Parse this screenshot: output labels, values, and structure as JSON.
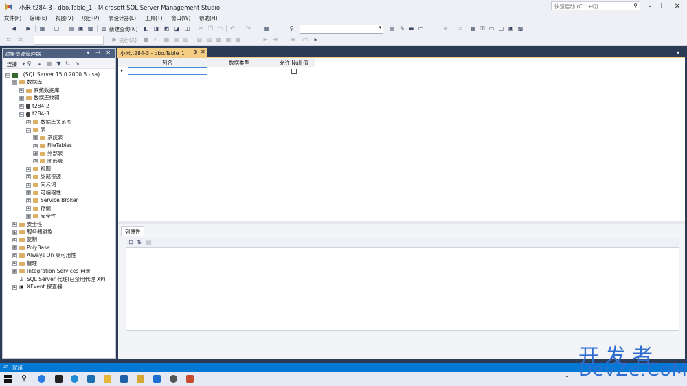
{
  "window": {
    "title": "小米.t284-3 - dbo.Table_1 - Microsoft SQL Server Management Studio",
    "quick_launch_placeholder": "快速启动 (Ctrl+Q)"
  },
  "menu": [
    "文件(F)",
    "编辑(E)",
    "视图(V)",
    "项目(P)",
    "表设计器(L)",
    "工具(T)",
    "窗口(W)",
    "帮助(H)"
  ],
  "toolbar": {
    "new_query_label": "新建查询(N)",
    "execute_label": "执行(X)"
  },
  "object_explorer": {
    "title": "对象资源管理器",
    "header_controls": "▾ ⊣ ✕",
    "connect_label": "连接",
    "tree": [
      {
        "label": ". (SQL Server 15.0.2000.5 - sa)",
        "level": 0,
        "icon": "server-icon",
        "expand": "⊟"
      },
      {
        "label": "数据库",
        "level": 1,
        "icon": "folder-icon",
        "expand": "⊟"
      },
      {
        "label": "系统数据库",
        "level": 2,
        "icon": "folder-icon",
        "expand": "⊞"
      },
      {
        "label": "数据库快照",
        "level": 2,
        "icon": "folder-icon",
        "expand": "⊞"
      },
      {
        "label": "t284-2",
        "level": 2,
        "icon": "database-icon",
        "expand": "⊞"
      },
      {
        "label": "t284-3",
        "level": 2,
        "icon": "database-icon",
        "expand": "⊟"
      },
      {
        "label": "数据库关系图",
        "level": 3,
        "icon": "folder-icon",
        "expand": "⊞"
      },
      {
        "label": "表",
        "level": 3,
        "icon": "folder-icon",
        "expand": "⊟"
      },
      {
        "label": "系统表",
        "level": 4,
        "icon": "folder-icon",
        "expand": "⊞"
      },
      {
        "label": "FileTables",
        "level": 4,
        "icon": "folder-icon",
        "expand": "⊞"
      },
      {
        "label": "外部表",
        "level": 4,
        "icon": "folder-icon",
        "expand": "⊞"
      },
      {
        "label": "图形表",
        "level": 4,
        "icon": "folder-icon",
        "expand": "⊞"
      },
      {
        "label": "视图",
        "level": 3,
        "icon": "folder-icon",
        "expand": "⊞"
      },
      {
        "label": "外部资源",
        "level": 3,
        "icon": "folder-icon",
        "expand": "⊞"
      },
      {
        "label": "同义词",
        "level": 3,
        "icon": "folder-icon",
        "expand": "⊞"
      },
      {
        "label": "可编程性",
        "level": 3,
        "icon": "folder-icon",
        "expand": "⊞"
      },
      {
        "label": "Service Broker",
        "level": 3,
        "icon": "folder-icon",
        "expand": "⊞"
      },
      {
        "label": "存储",
        "level": 3,
        "icon": "folder-icon",
        "expand": "⊞"
      },
      {
        "label": "安全性",
        "level": 3,
        "icon": "folder-icon",
        "expand": "⊞"
      },
      {
        "label": "安全性",
        "level": 1,
        "icon": "folder-icon",
        "expand": "⊞"
      },
      {
        "label": "服务器对象",
        "level": 1,
        "icon": "folder-icon",
        "expand": "⊞"
      },
      {
        "label": "复制",
        "level": 1,
        "icon": "folder-icon",
        "expand": "⊞"
      },
      {
        "label": "PolyBase",
        "level": 1,
        "icon": "folder-icon",
        "expand": "⊞"
      },
      {
        "label": "Always On 高可用性",
        "level": 1,
        "icon": "folder-icon",
        "expand": "⊞"
      },
      {
        "label": "管理",
        "level": 1,
        "icon": "folder-icon",
        "expand": "⊞"
      },
      {
        "label": "Integration Services 目录",
        "level": 1,
        "icon": "folder-icon",
        "expand": "⊞"
      },
      {
        "label": "SQL Server 代理(已禁用代理 XP)",
        "level": 1,
        "icon": "agent-icon",
        "expand": ""
      },
      {
        "label": "XEvent 探查器",
        "level": 1,
        "icon": "xevent-icon",
        "expand": "⊞"
      }
    ]
  },
  "document_tab": {
    "label": "小米.t284-3 - dbo.Table_1",
    "pin_glyph": "⊕",
    "close_glyph": "✕"
  },
  "designer": {
    "columns": [
      "列名",
      "数据类型",
      "允许 Null 值"
    ],
    "row_indicator": "▸",
    "name_value": "",
    "allow_null": false
  },
  "properties": {
    "tab_label": "列属性"
  },
  "statusbar": {
    "text": "就绪"
  },
  "watermark": {
    "top": "开发者",
    "bottom": "DevZe.CoM"
  },
  "colors": {
    "accent_tab": "#f5cc84",
    "statusbar": "#0078d4",
    "panel_header": "#4d6082"
  }
}
